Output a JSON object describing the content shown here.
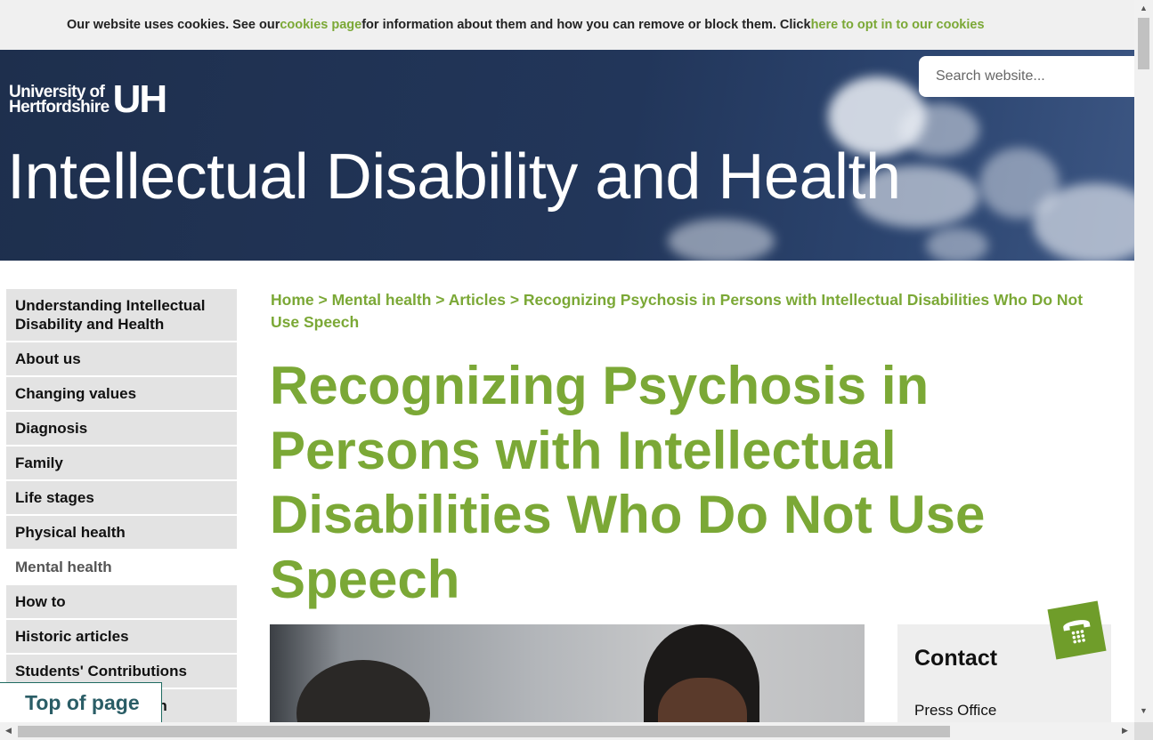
{
  "cookie_banner": {
    "text_before": "Our website uses cookies. See our ",
    "link1": "cookies page",
    "text_middle": " for information about them and how you can remove or block them. Click ",
    "link2": "here to opt in to our cookies"
  },
  "header": {
    "logo_line1": "University of",
    "logo_line2": "Hertfordshire",
    "logo_mark": "UH",
    "site_title": "Intellectual Disability and Health",
    "search_placeholder": "Search website..."
  },
  "sidebar": {
    "items": [
      {
        "label": "Understanding Intellectual Disability and Health"
      },
      {
        "label": "About us"
      },
      {
        "label": "Changing values"
      },
      {
        "label": "Diagnosis"
      },
      {
        "label": "Family"
      },
      {
        "label": "Life stages"
      },
      {
        "label": "Physical health"
      },
      {
        "label": "Mental health"
      },
      {
        "label": "How to"
      },
      {
        "label": "Historic articles"
      },
      {
        "label": "Students' Contributions"
      },
      {
        "label": "on"
      }
    ],
    "active_index": 7
  },
  "top_of_page": "Top of page",
  "breadcrumb": {
    "items": [
      "Home",
      "Mental health",
      "Articles",
      "Recognizing Psychosis in Persons with Intellectual Disabilities Who Do Not Use Speech"
    ],
    "separator": ">"
  },
  "page_title": "Recognizing Psychosis in Persons with Intellectual Disabilities Who Do Not Use Speech",
  "contact": {
    "heading": "Contact",
    "press": "Press Office"
  },
  "icons": {
    "phone": "phone-icon"
  },
  "colors": {
    "accent_green": "#7ba836",
    "header_navy": "#1e2f4d"
  }
}
